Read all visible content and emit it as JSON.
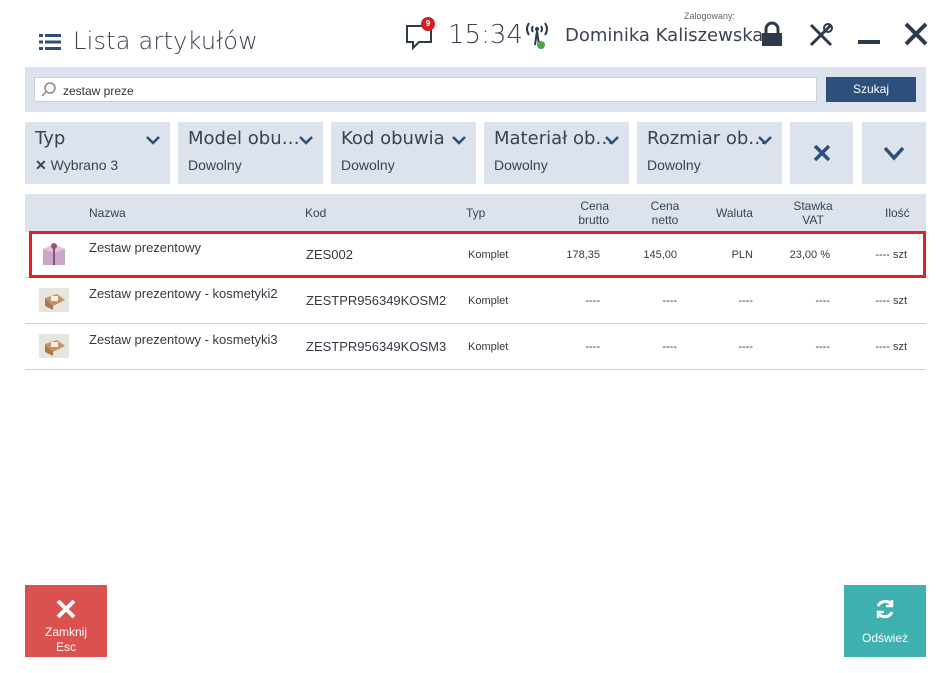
{
  "header": {
    "title": "Lista artykułów",
    "notification_count": "9",
    "clock": "15:34",
    "logged_label": "Zalogowany:",
    "user_name": "Dominika Kaliszewska"
  },
  "search": {
    "value": "zestaw preze",
    "button_label": "Szukaj"
  },
  "filters": [
    {
      "label": "Typ",
      "value": "Wybrano 3",
      "has_clear": true
    },
    {
      "label": "Model obu…",
      "value": "Dowolny"
    },
    {
      "label": "Kod obuwia",
      "value": "Dowolny"
    },
    {
      "label": "Materiał ob…",
      "value": "Dowolny"
    },
    {
      "label": "Rozmiar ob…",
      "value": "Dowolny"
    }
  ],
  "table": {
    "columns": {
      "name": "Nazwa",
      "code": "Kod",
      "type": "Typ",
      "gross_1": "Cena",
      "gross_2": "brutto",
      "net_1": "Cena",
      "net_2": "netto",
      "currency": "Waluta",
      "vat_1": "Stawka",
      "vat_2": "VAT",
      "qty": "Ilość"
    },
    "rows": [
      {
        "name": "Zestaw prezentowy",
        "code": "ZES002",
        "type": "Komplet",
        "gross": "178,35",
        "net": "145,00",
        "currency": "PLN",
        "vat": "23,00 %",
        "qty": "---- szt"
      },
      {
        "name": "Zestaw prezentowy - kosmetyki2",
        "code": "ZESTPR956349KOSM2",
        "type": "Komplet",
        "gross": "----",
        "net": "----",
        "currency": "----",
        "vat": "----",
        "qty": "---- szt"
      },
      {
        "name": "Zestaw prezentowy - kosmetyki3",
        "code": "ZESTPR956349KOSM3",
        "type": "Komplet",
        "gross": "----",
        "net": "----",
        "currency": "----",
        "vat": "----",
        "qty": "---- szt"
      }
    ]
  },
  "footer": {
    "close_label": "Zamknij",
    "close_shortcut": "Esc",
    "refresh_label": "Odśwież"
  }
}
